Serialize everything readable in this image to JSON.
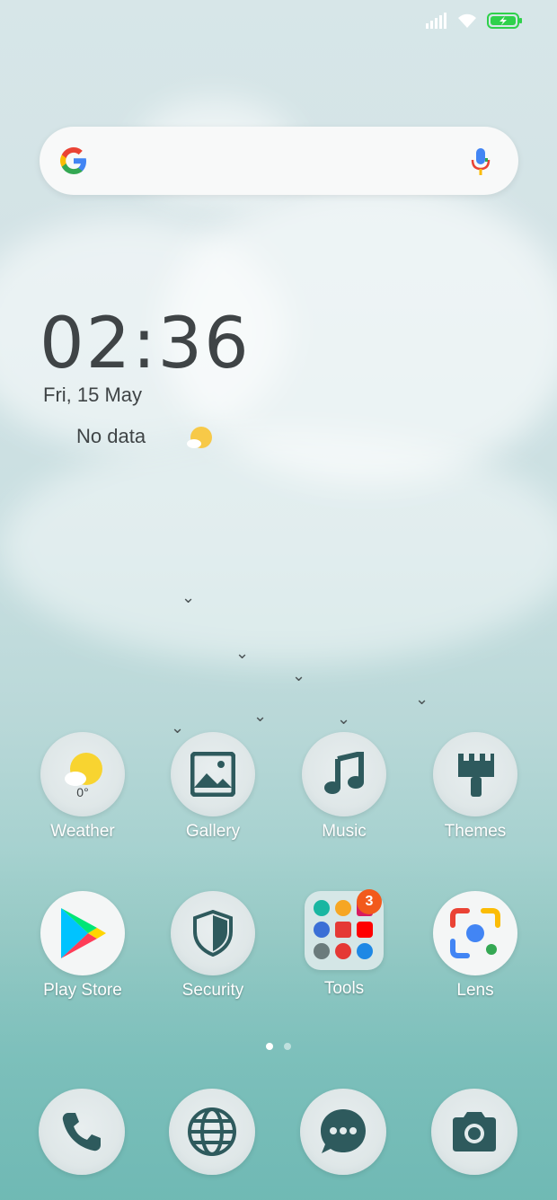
{
  "status_bar": {
    "icons": [
      "signal-icon",
      "wifi-icon",
      "battery-charging-icon"
    ],
    "battery_color": "#2fd14b"
  },
  "search": {
    "logo": "google-logo-icon",
    "voice": "mic-icon"
  },
  "clock": {
    "time": "02:36",
    "date": "Fri, 15 May",
    "weather_text": "No data"
  },
  "apps_row1": [
    {
      "label": "Weather",
      "sub": "0°",
      "icon": "weather-sun-icon"
    },
    {
      "label": "Gallery",
      "icon": "gallery-icon"
    },
    {
      "label": "Music",
      "icon": "music-note-icon"
    },
    {
      "label": "Themes",
      "icon": "paintbrush-icon"
    }
  ],
  "apps_row2": [
    {
      "label": "Play Store",
      "icon": "play-store-icon"
    },
    {
      "label": "Security",
      "icon": "shield-icon"
    },
    {
      "label": "Tools",
      "icon": "folder-icon",
      "badge": "3"
    },
    {
      "label": "Lens",
      "icon": "lens-icon"
    }
  ],
  "page_indicator": {
    "pages": 2,
    "current": 1
  },
  "dock": [
    {
      "icon": "phone-icon"
    },
    {
      "icon": "browser-globe-icon"
    },
    {
      "icon": "messages-icon"
    },
    {
      "icon": "camera-icon"
    }
  ],
  "colors": {
    "icon_fg": "#2e5a5d",
    "badge": "#f25a1c"
  }
}
